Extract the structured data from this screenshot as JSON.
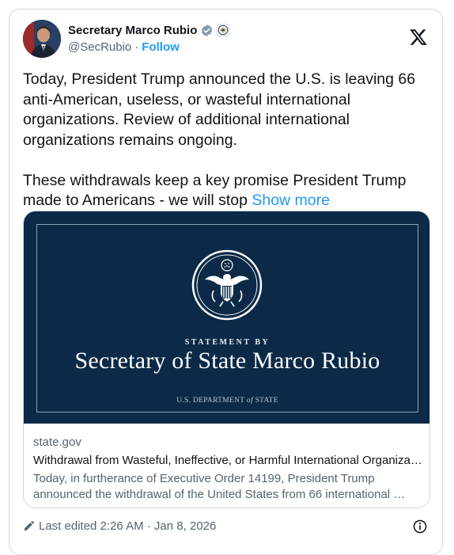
{
  "author": {
    "name": "Secretary Marco Rubio",
    "handle": "@SecRubio",
    "separator": "·",
    "follow_label": "Follow",
    "verified_icon": "verified-check-icon",
    "affiliation_icon": "state-department-seal-icon"
  },
  "platform_icon": "x-logo-icon",
  "tweet": {
    "paragraph_1": "Today, President Trump announced the U.S. is leaving 66 anti-American, useless, or wasteful international organizations. Review of additional international organizations remains ongoing.",
    "paragraph_2": "These withdrawals keep a key promise President Trump made to Americans - we will stop ",
    "show_more": "Show more"
  },
  "link_card": {
    "image": {
      "statement_by": "STATEMENT BY",
      "headline": "Secretary of State Marco Rubio",
      "department_prefix": "U.S. DEPARTMENT ",
      "department_of": "of",
      "department_suffix": " STATE"
    },
    "domain": "state.gov",
    "title": "Withdrawal from Wasteful, Ineffective, or Harmful International Organiza…",
    "description": "Today, in furtherance of Executive Order 14199, President Trump announced the withdrawal of the United States from 66 international …"
  },
  "footer": {
    "edited_label": "Last edited 2:26 AM · Jan 8, 2026",
    "edit_icon": "pencil-icon",
    "info_icon": "info-icon"
  },
  "colors": {
    "accent": "#1d9bf0",
    "text": "#0f1419",
    "muted": "#536471",
    "border": "#cfd9de",
    "statement_bg": "#0c2a47"
  }
}
